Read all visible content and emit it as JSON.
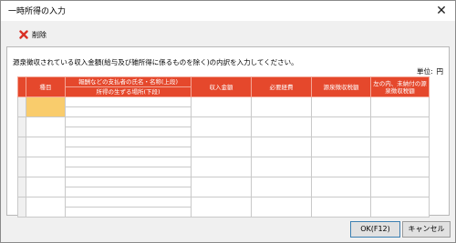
{
  "window": {
    "title": "一時所得の入力",
    "close_glyph": "✕"
  },
  "toolbar": {
    "delete_label": "削除",
    "delete_icon": "red-x-icon",
    "delete_color": "#d93025"
  },
  "main": {
    "instruction": "源泉徴収されている収入金額(給与及び雑所得に係るものを除く)の内訳を入力してください。",
    "unit_label": "単位:",
    "unit_value": "円"
  },
  "table": {
    "header_color": "#e5482c",
    "selected_color": "#f9cc6c",
    "columns": {
      "kind": "種目",
      "payer_top": "報酬などの支払者の氏名・名称(上段)",
      "payer_bottom": "所得の生ずる場所(下段)",
      "income": "収入金額",
      "expenses": "必要経費",
      "withholding": "源泉徴収税額",
      "unpaid_withholding": "左の内、未納付の源泉徴収税額"
    },
    "row_count": 6
  },
  "footer": {
    "ok_label": "OK(F12)",
    "cancel_label": "キャンセル"
  }
}
